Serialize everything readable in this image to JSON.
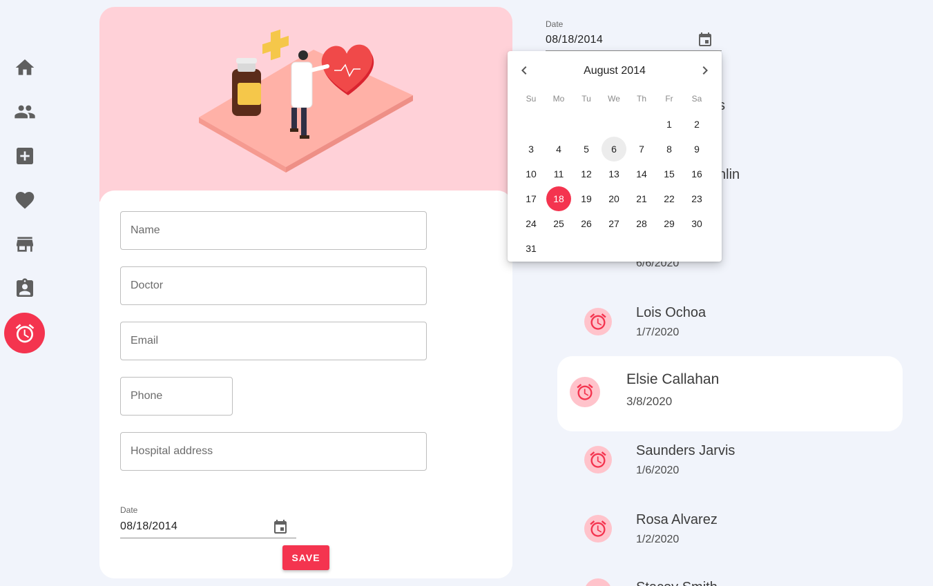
{
  "sidebar": {
    "items": [
      {
        "icon": "home-icon"
      },
      {
        "icon": "people-icon"
      },
      {
        "icon": "medical-plus-icon"
      },
      {
        "icon": "heart-icon"
      },
      {
        "icon": "store-icon"
      },
      {
        "icon": "clipboard-person-icon"
      },
      {
        "icon": "alarm-icon",
        "active": true
      }
    ]
  },
  "form": {
    "name_placeholder": "Name",
    "doctor_placeholder": "Doctor",
    "email_placeholder": "Email",
    "phone_placeholder": "Phone",
    "address_placeholder": "Hospital address",
    "date_label": "Date",
    "date_value": "08/18/2014",
    "save_label": "SAVE"
  },
  "list_filter": {
    "date_label": "Date",
    "date_value": "08/18/2014"
  },
  "date_picker": {
    "month_label": "August 2014",
    "weekdays": [
      "Su",
      "Mo",
      "Tu",
      "We",
      "Th",
      "Fr",
      "Sa"
    ],
    "days": [
      "1",
      "2",
      "3",
      "4",
      "5",
      "6",
      "7",
      "8",
      "9",
      "10",
      "11",
      "12",
      "13",
      "14",
      "15",
      "16",
      "17",
      "18",
      "19",
      "20",
      "21",
      "22",
      "23",
      "24",
      "25",
      "26",
      "27",
      "28",
      "29",
      "30",
      "31"
    ],
    "today": "6",
    "selected": "18"
  },
  "appointments": {
    "partial_1_name_tail": "s",
    "partial_2_name_tail": "hlin",
    "partial_3_date": "6/6/2020",
    "items": [
      {
        "name": "Lois Ochoa",
        "date": "1/7/2020"
      },
      {
        "name": "Elsie Callahan",
        "date": "3/8/2020"
      },
      {
        "name": "Saunders Jarvis",
        "date": "1/6/2020"
      },
      {
        "name": "Rosa Alvarez",
        "date": "1/2/2020"
      },
      {
        "name": "Stacey Smith",
        "date": ""
      }
    ]
  },
  "colors": {
    "accent": "#f4344f",
    "hero_bg": "#ffd1d8",
    "page_bg": "#f1f4fb"
  }
}
